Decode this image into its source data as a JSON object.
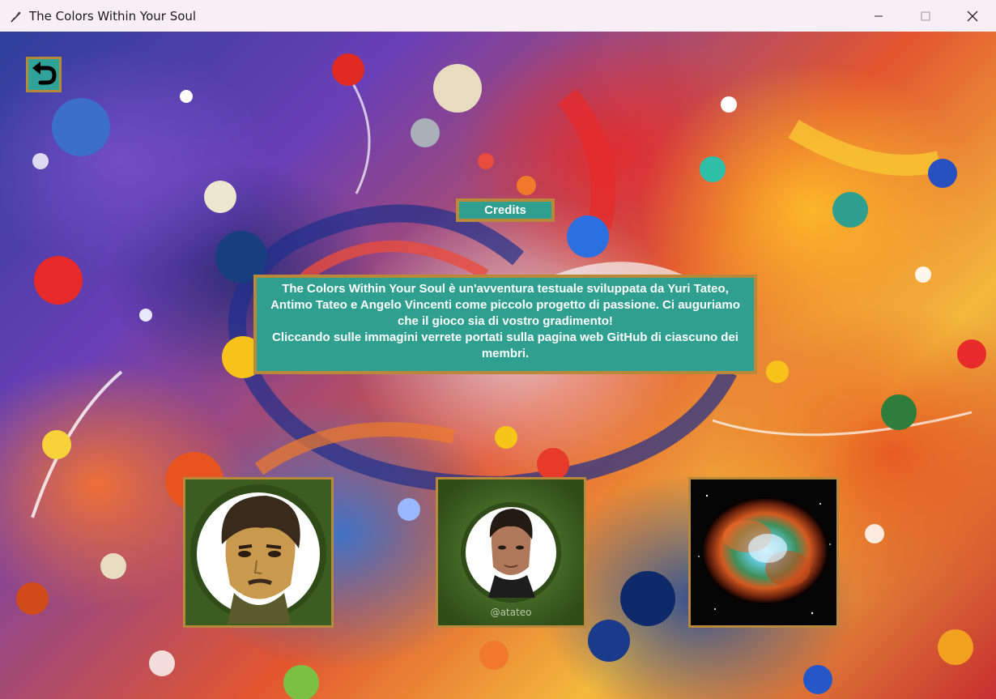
{
  "window": {
    "title": "The Colors Within Your Soul"
  },
  "credits": {
    "heading": "Credits",
    "paragraph1": "The Colors Within Your Soul è un'avventura testuale sviluppata da Yuri Tateo, Antimo Tateo e Angelo Vincenti come piccolo progetto di passione. Ci auguriamo che il gioco sia di vostro gradimento!",
    "paragraph2": "Cliccando sulle immagini verrete portati sulla pagina web GitHub di ciascuno dei membri."
  },
  "members": [
    {
      "icon": "avatar-cartoon-man"
    },
    {
      "icon": "avatar-portrait-man",
      "handle": "@atateo"
    },
    {
      "icon": "nebula-image"
    }
  ],
  "colors": {
    "panel": "#2fa090",
    "border": "#b8893a",
    "titlebar": "#f7eef6"
  }
}
